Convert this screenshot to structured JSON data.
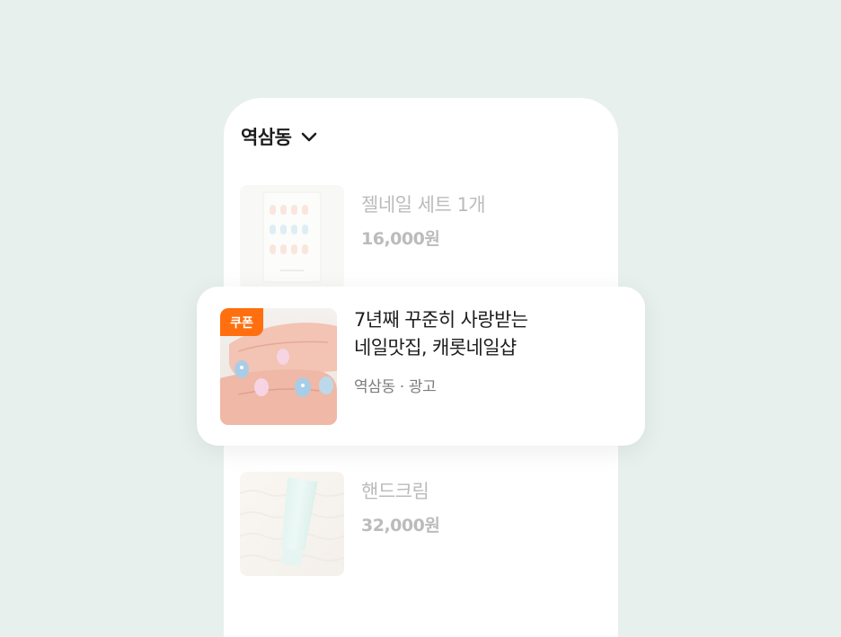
{
  "location": {
    "label": "역삼동",
    "icon": "chevron-down-icon"
  },
  "listings": [
    {
      "title": "젤네일 세트 1개",
      "price": "16,000원",
      "image": "nail-tip-set"
    },
    {
      "title": "핸드크림",
      "price": "32,000원",
      "image": "hand-cream-tube"
    }
  ],
  "ad": {
    "badge": "쿠폰",
    "title_line1": "7년째 꾸준히 사랑받는",
    "title_line2": "네일맛집, 캐롯네일샵",
    "meta": "역삼동 · 광고",
    "image": "manicured-hands"
  },
  "colors": {
    "background": "#e7f0ec",
    "badge": "#ff6f0f",
    "card": "#ffffff"
  }
}
